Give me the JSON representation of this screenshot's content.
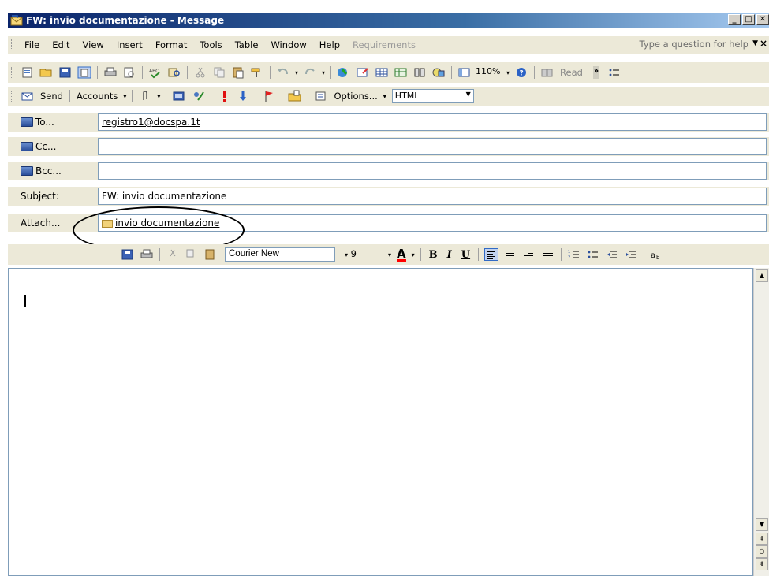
{
  "window": {
    "title": "FW: invio  documentazione - Message"
  },
  "menu": {
    "items": [
      "File",
      "Edit",
      "View",
      "Insert",
      "Format",
      "Tools",
      "Table",
      "Window",
      "Help"
    ],
    "disabled_item": "Requirements",
    "help_placeholder": "Type a question for help"
  },
  "standard_toolbar": {
    "zoom": "110%",
    "read_label": "Read"
  },
  "send_toolbar": {
    "send_label": "Send",
    "accounts_label": "Accounts",
    "options_label": "Options...",
    "format_label": "HTML"
  },
  "header": {
    "to_label": "To...",
    "to_value": "registro1@docspa.1t",
    "cc_label": "Cc...",
    "cc_value": "",
    "bcc_label": "Bcc...",
    "bcc_value": "",
    "subject_label": "Subject:",
    "subject_value": "FW: invio  documentazione",
    "attach_label": "Attach...",
    "attachment_name": "invio  documentazione"
  },
  "formatting_toolbar": {
    "font_name": "Courier New",
    "font_size": "9",
    "bold": "B",
    "italic": "I",
    "underline": "U",
    "font_color_glyph": "A"
  },
  "colors": {
    "titlebar": "#0a246a",
    "toolbar_bg": "#ece9d8",
    "field_border": "#7f9db9"
  }
}
